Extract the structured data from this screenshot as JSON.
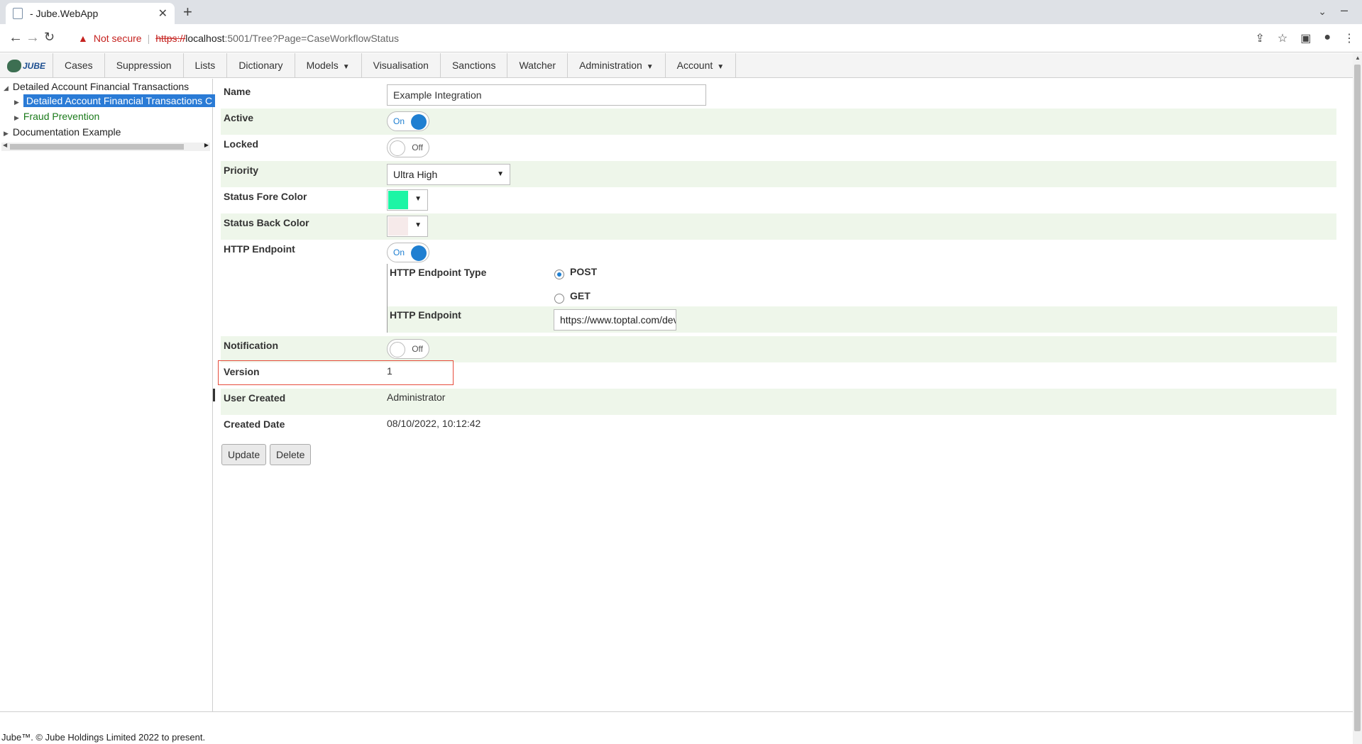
{
  "browser": {
    "tab_title": "- Jube.WebApp",
    "not_secure": "Not secure",
    "url_protocol": "https://",
    "url_host": "localhost",
    "url_path": ":5001/Tree?Page=CaseWorkflowStatus"
  },
  "nav": {
    "logo": "JUBE",
    "items": [
      "Cases",
      "Suppression",
      "Lists",
      "Dictionary",
      "Models",
      "Visualisation",
      "Sanctions",
      "Watcher",
      "Administration",
      "Account"
    ]
  },
  "tree": {
    "root1": "Detailed Account Financial Transactions",
    "child_selected": "Detailed Account Financial Transactions C",
    "child2": "Fraud Prevention",
    "root2": "Documentation Example"
  },
  "form": {
    "name_label": "Name",
    "name_value": "Example Integration",
    "active_label": "Active",
    "active_state": "On",
    "locked_label": "Locked",
    "locked_state": "Off",
    "priority_label": "Priority",
    "priority_value": "Ultra High",
    "fore_label": "Status Fore Color",
    "fore_color": "#1cf5a5",
    "back_label": "Status Back Color",
    "back_color": "#f6eaea",
    "http_label": "HTTP Endpoint",
    "http_state": "On",
    "http_type_label": "HTTP Endpoint Type",
    "post_label": "POST",
    "get_label": "GET",
    "http_endpoint_label": "HTTP Endpoint",
    "http_endpoint_value": "https://www.toptal.com/developers/postbin",
    "notification_label": "Notification",
    "notification_state": "Off",
    "version_label": "Version",
    "version_value": "1",
    "user_created_label": "User Created",
    "user_created_value": "Administrator",
    "created_date_label": "Created Date",
    "created_date_value": "08/10/2022, 10:12:42",
    "update_button": "Update",
    "delete_button": "Delete"
  },
  "footer": {
    "text": "Jube™. © Jube Holdings Limited 2022 to present."
  }
}
